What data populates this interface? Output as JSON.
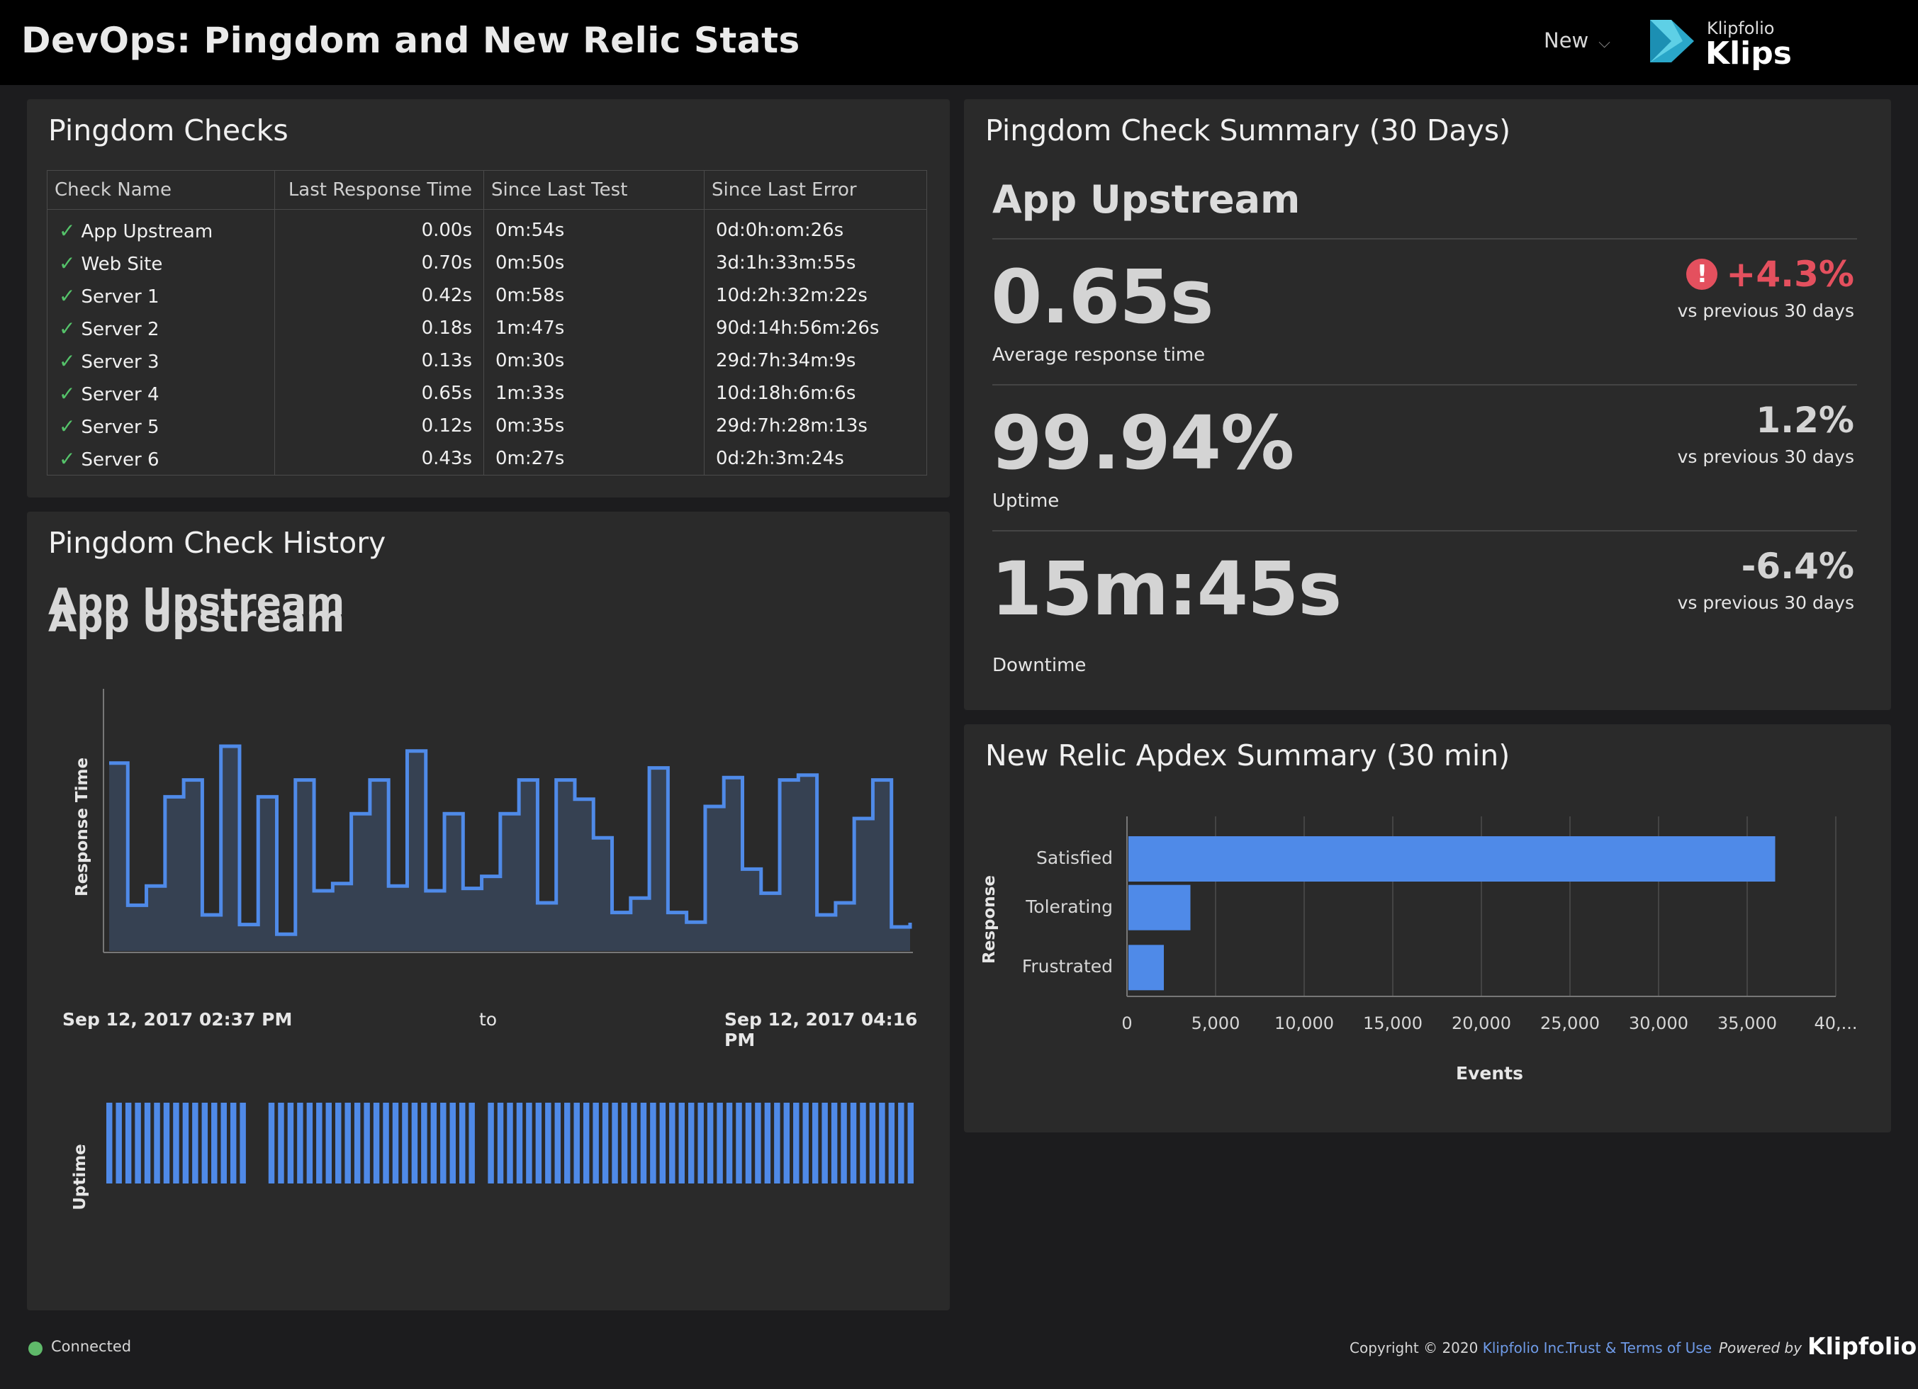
{
  "header": {
    "title": "DevOps: Pingdom and New Relic Stats",
    "new_label": "New",
    "logo_small": "Klipfolio",
    "logo_big": "Klips"
  },
  "checks_panel": {
    "title": "Pingdom Checks",
    "columns": [
      "Check Name",
      "Last Response Time",
      "Since Last Test",
      "Since Last Error"
    ],
    "rows": [
      {
        "name": "App Upstream",
        "response": "0.00s",
        "since_test": "0m:54s",
        "since_error": "0d:0h:om:26s"
      },
      {
        "name": "Web Site",
        "response": "0.70s",
        "since_test": "0m:50s",
        "since_error": "3d:1h:33m:55s"
      },
      {
        "name": "Server 1",
        "response": "0.42s",
        "since_test": "0m:58s",
        "since_error": "10d:2h:32m:22s"
      },
      {
        "name": "Server 2",
        "response": "0.18s",
        "since_test": "1m:47s",
        "since_error": "90d:14h:56m:26s"
      },
      {
        "name": "Server 3",
        "response": "0.13s",
        "since_test": "0m:30s",
        "since_error": "29d:7h:34m:9s"
      },
      {
        "name": "Server 4",
        "response": "0.65s",
        "since_test": "1m:33s",
        "since_error": "10d:18h:6m:6s"
      },
      {
        "name": "Server 5",
        "response": "0.12s",
        "since_test": "0m:35s",
        "since_error": "29d:7h:28m:13s"
      },
      {
        "name": "Server 6",
        "response": "0.43s",
        "since_test": "0m:27s",
        "since_error": "0d:2h:3m:24s"
      }
    ]
  },
  "history_panel": {
    "title": "Pingdom Check History",
    "subtitle": "App Upstream",
    "y_label": "Response Time",
    "uptime_label": "Uptime",
    "date_from": "Sep 12, 2017 02:37 PM",
    "date_sep": "to",
    "date_to": "Sep 12, 2017 04:16 PM",
    "accent_color": "#4f8ae8"
  },
  "summary_panel": {
    "title": "Pingdom Check Summary (30 Days)",
    "subtitle": "App Upstream",
    "metrics": [
      {
        "value": "0.65s",
        "label": "Average response time",
        "delta": "+4.3%",
        "delta_note": "vs previous 30 days",
        "alert": true
      },
      {
        "value": "99.94%",
        "label": "Uptime",
        "delta": "1.2%",
        "delta_note": "vs previous 30 days",
        "alert": false
      },
      {
        "value": "15m:45s",
        "label": "Downtime",
        "delta": "-6.4%",
        "delta_note": "vs previous 30 days",
        "alert": false
      }
    ],
    "alert_color": "#e4505e"
  },
  "apdex_panel": {
    "title": "New Relic Apdex Summary (30 min)",
    "x_label": "Events",
    "y_label": "Response"
  },
  "chart_data": [
    {
      "type": "line",
      "title": "App Upstream",
      "ylabel": "Response Time",
      "x_range": [
        "Sep 12, 2017 02:37 PM",
        "Sep 12, 2017 04:16 PM"
      ],
      "step": true,
      "y_relative": [
        0.78,
        0.19,
        0.27,
        0.64,
        0.71,
        0.15,
        0.85,
        0.11,
        0.64,
        0.07,
        0.71,
        0.25,
        0.28,
        0.57,
        0.71,
        0.27,
        0.83,
        0.25,
        0.57,
        0.26,
        0.31,
        0.57,
        0.71,
        0.2,
        0.71,
        0.63,
        0.47,
        0.16,
        0.22,
        0.76,
        0.16,
        0.12,
        0.6,
        0.72,
        0.34,
        0.24,
        0.71,
        0.73,
        0.15,
        0.2,
        0.55,
        0.71,
        0.1
      ]
    },
    {
      "type": "bar",
      "title": "",
      "ylabel": "Uptime",
      "values": [
        1,
        1,
        1,
        1,
        1,
        1,
        1,
        1,
        1,
        1,
        1,
        1,
        1,
        1,
        1,
        0,
        0,
        1,
        1,
        1,
        1,
        1,
        1,
        1,
        1,
        1,
        1,
        1,
        1,
        1,
        1,
        1,
        1,
        1,
        1,
        1,
        1,
        1,
        1,
        0,
        1,
        1,
        1,
        1,
        1,
        1,
        1,
        1,
        1,
        1,
        1,
        1,
        1,
        1,
        1,
        1,
        1,
        1,
        1,
        1,
        1,
        1,
        1,
        1,
        1,
        1,
        1,
        1,
        1,
        1,
        1,
        1,
        1,
        1,
        1,
        1,
        1,
        1,
        1,
        1,
        1,
        1,
        1,
        1,
        1
      ]
    },
    {
      "type": "bar",
      "orientation": "horizontal",
      "title": "New Relic Apdex Summary (30 min)",
      "categories": [
        "Satisfied",
        "Tolerating",
        "Frustrated"
      ],
      "values": [
        36500,
        3500,
        2000
      ],
      "xlabel": "Events",
      "ylabel": "Response",
      "xlim": [
        0,
        40000
      ],
      "x_ticks": [
        "0",
        "5,000",
        "10,000",
        "15,000",
        "20,000",
        "25,000",
        "30,000",
        "35,000",
        "40,..."
      ],
      "grid": true,
      "color": "#4f8ae8"
    }
  ],
  "footer": {
    "status": "Connected",
    "copyright": "Copyright © 2020",
    "company": "Klipfolio Inc.",
    "terms": "Trust & Terms of Use",
    "powered": "Powered by",
    "brand": "Klipfolio"
  }
}
